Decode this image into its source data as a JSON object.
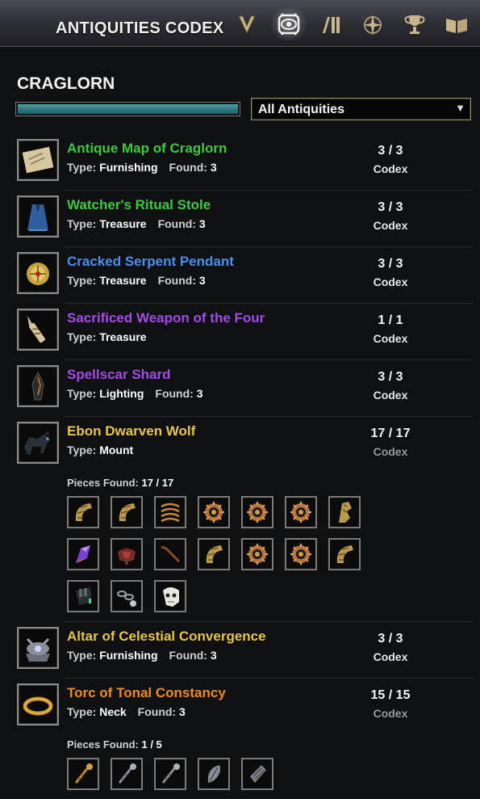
{
  "header": {
    "title": "ANTIQUITIES CODEX",
    "tabs": [
      {
        "icon": "scrying-v-icon",
        "active": false
      },
      {
        "icon": "codex-eye-icon",
        "active": true
      },
      {
        "icon": "journal-bars-icon",
        "active": false
      },
      {
        "icon": "compass-star-icon",
        "active": false
      },
      {
        "icon": "trophy-icon",
        "active": false
      },
      {
        "icon": "open-book-icon",
        "active": false
      }
    ]
  },
  "zone": {
    "name": "CRAGLORN",
    "progress_fraction": 1.0,
    "filter_selected": "All Antiquities"
  },
  "labels": {
    "type": "Type:",
    "found": "Found:",
    "pieces_found": "Pieces Found:"
  },
  "colors": {
    "green": "#3ec93e",
    "blue": "#4a8ff0",
    "purple": "#a54ae8",
    "gold": "#e9c547",
    "orange": "#f08a1e"
  },
  "antiquities": [
    {
      "name": "Antique Map of Craglorn",
      "quality": "green",
      "type": "Furnishing",
      "found": "3",
      "count": "3 / 3",
      "codex": "Codex",
      "icon": "map-scroll-icon"
    },
    {
      "name": "Watcher's Ritual Stole",
      "quality": "green",
      "type": "Treasure",
      "found": "3",
      "count": "3 / 3",
      "codex": "Codex",
      "icon": "robe-icon"
    },
    {
      "name": "Cracked Serpent Pendant",
      "quality": "blue",
      "type": "Treasure",
      "found": "3",
      "count": "3 / 3",
      "codex": "Codex",
      "icon": "pendant-icon"
    },
    {
      "name": "Sacrificed Weapon of the Four",
      "quality": "purple",
      "type": "Treasure",
      "found": "",
      "count": "1 / 1",
      "codex": "Codex",
      "icon": "dagger-icon"
    },
    {
      "name": "Spellscar Shard",
      "quality": "purple",
      "type": "Lighting",
      "found": "3",
      "count": "3 / 3",
      "codex": "Codex",
      "icon": "shard-icon"
    },
    {
      "name": "Ebon Dwarven Wolf",
      "quality": "gold",
      "type": "Mount",
      "found": "",
      "count": "17 / 17",
      "codex": "Codex",
      "codex_dim": true,
      "icon": "wolf-mount-icon",
      "pieces_found": "17 / 17",
      "pieces": [
        "horn-piece-icon",
        "horn-piece-icon",
        "coil-piece-icon",
        "gear-piece-icon",
        "gear-piece-icon",
        "gear-piece-icon",
        "claw-piece-icon",
        "crystal-piece-icon",
        "saddle-piece-icon",
        "rod-piece-icon",
        "horn-piece-icon",
        "gear-piece-icon",
        "gear-piece-icon",
        "horn-piece-icon",
        "paw-piece-icon",
        "chain-piece-icon",
        "skull-piece-icon"
      ]
    },
    {
      "name": "Altar of Celestial Convergence",
      "quality": "gold",
      "type": "Furnishing",
      "found": "3",
      "count": "3 / 3",
      "codex": "Codex",
      "icon": "altar-icon"
    },
    {
      "name": "Torc of Tonal Constancy",
      "quality": "orange",
      "type": "Neck",
      "found": "3",
      "count": "15 / 15",
      "codex": "Codex",
      "codex_dim": true,
      "icon": "torc-icon",
      "pieces_found": "1 / 5",
      "pieces": [
        "staff-gold-piece-icon",
        "staff-silver-piece-icon",
        "staff-silver-piece-icon",
        "feather-piece-icon",
        "fragment-piece-icon"
      ]
    }
  ]
}
